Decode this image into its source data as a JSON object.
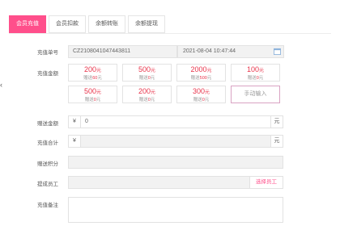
{
  "tabs": [
    {
      "label": "会员充值",
      "active": true
    },
    {
      "label": "会员扣款",
      "active": false
    },
    {
      "label": "余额转账",
      "active": false
    },
    {
      "label": "余额提现",
      "active": false
    }
  ],
  "form": {
    "order_no_label": "充值单号",
    "order_no_value": "CZ2108041047443811",
    "datetime_value": "2021-08-04 10:47:44",
    "amount_label": "充值金额",
    "gift_label": "赠送金额",
    "gift_prefix": "¥",
    "gift_value": "0",
    "gift_suffix": "元",
    "total_label": "充值合计",
    "total_prefix": "¥",
    "total_suffix": "元",
    "points_label": "赠送积分",
    "staff_label": "提成员工",
    "staff_button": "选择员工",
    "remark_label": "充值备注"
  },
  "amount_options": [
    {
      "amount": "200",
      "unit": "元",
      "gift_prefix": "赠送",
      "gift": "60",
      "gift_unit": "元"
    },
    {
      "amount": "500",
      "unit": "元",
      "gift_prefix": "赠送",
      "gift": "0",
      "gift_unit": "元"
    },
    {
      "amount": "2000",
      "unit": "元",
      "gift_prefix": "赠送",
      "gift": "500",
      "gift_unit": "元"
    },
    {
      "amount": "100",
      "unit": "元",
      "gift_prefix": "赠送",
      "gift": "0",
      "gift_unit": "元"
    },
    {
      "amount": "500",
      "unit": "元",
      "gift_prefix": "赠送",
      "gift": "0",
      "gift_unit": "元"
    },
    {
      "amount": "200",
      "unit": "元",
      "gift_prefix": "赠送",
      "gift": "0",
      "gift_unit": "元"
    },
    {
      "amount": "300",
      "unit": "元",
      "gift_prefix": "赠送",
      "gift": "0",
      "gift_unit": "元"
    }
  ],
  "manual_input_label": "手动输入",
  "colors": {
    "accent": "#ff4f8b",
    "amount_red": "#e8334a"
  }
}
